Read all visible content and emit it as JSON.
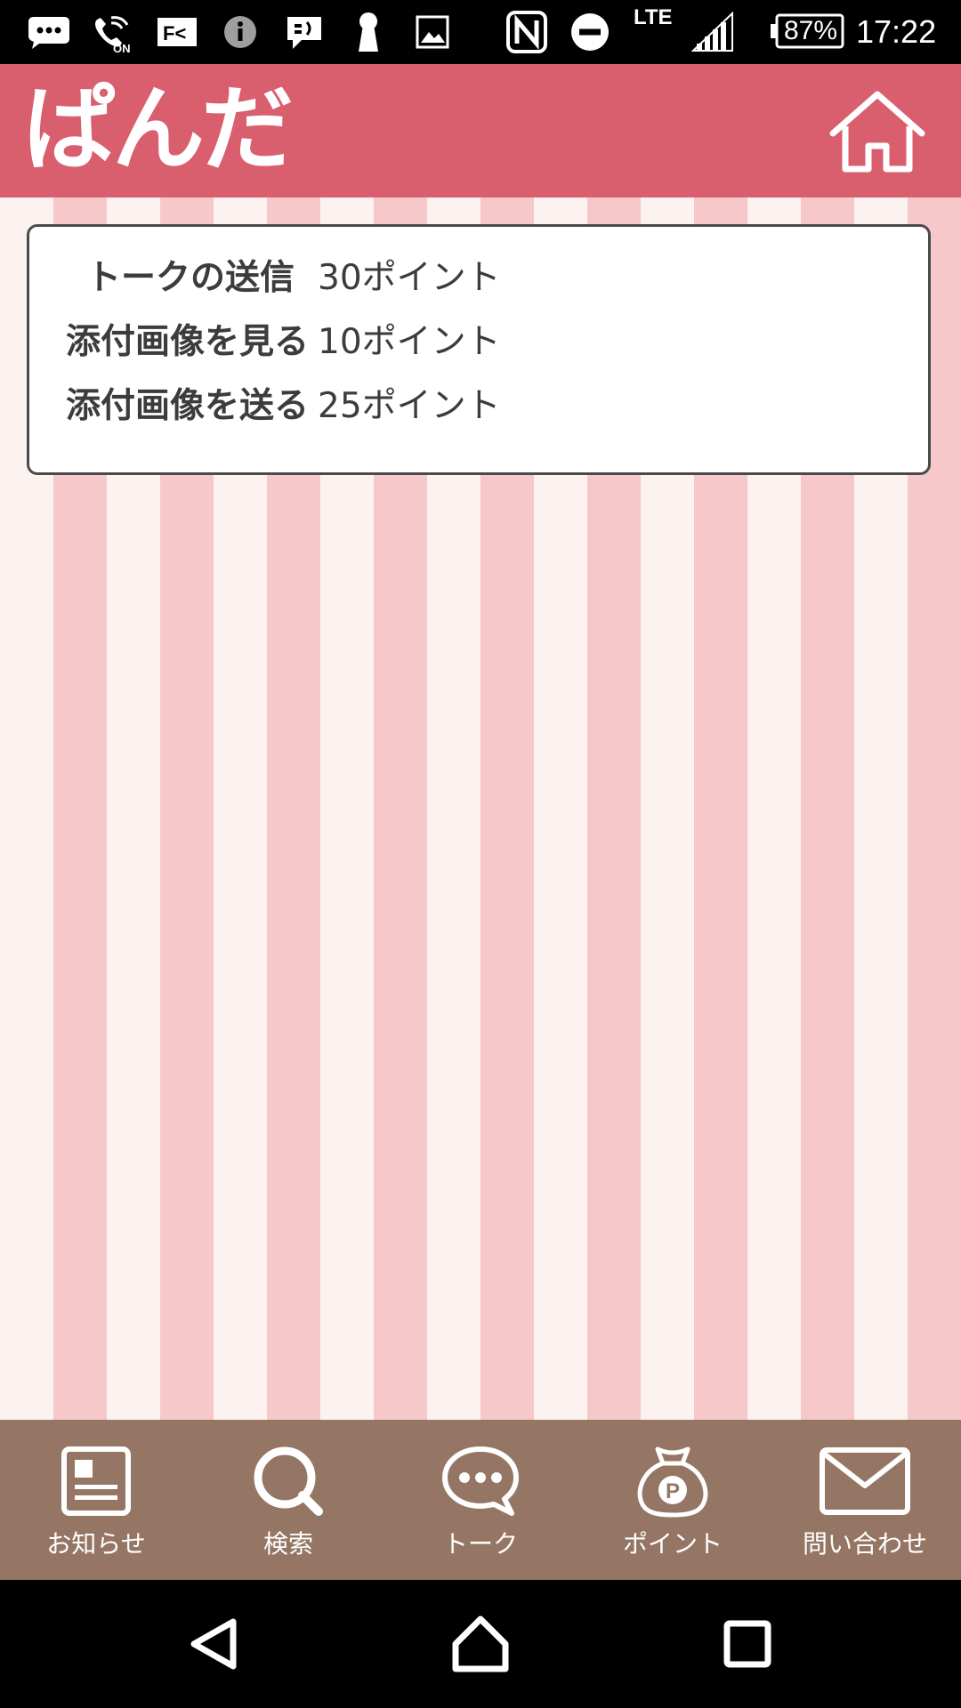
{
  "status_bar": {
    "icons": [
      "chat-icon",
      "wifi-calling-on-icon",
      "fk-app-icon",
      "info-icon",
      "message-icon",
      "keyhole-icon",
      "image-icon",
      "nfc-icon",
      "do-not-disturb-icon",
      "cellular-signal-icon",
      "battery-icon"
    ],
    "network": "LTE",
    "battery": "87%",
    "time": "17:22"
  },
  "header": {
    "logo_text": "ぱんだ",
    "home_icon": "home-icon",
    "brand_color": "#d95f6e"
  },
  "rates": [
    {
      "label": "トークの送信",
      "value": "30ポイント"
    },
    {
      "label": "添付画像を見る",
      "value": "10ポイント"
    },
    {
      "label": "添付画像を送る",
      "value": "25ポイント"
    }
  ],
  "tabs": [
    {
      "label": "お知らせ",
      "icon": "news-icon"
    },
    {
      "label": "検索",
      "icon": "search-icon"
    },
    {
      "label": "トーク",
      "icon": "chat-bubble-icon"
    },
    {
      "label": "ポイント",
      "icon": "point-bag-icon"
    },
    {
      "label": "問い合わせ",
      "icon": "mail-icon"
    }
  ],
  "colors": {
    "tab_bar": "#957563",
    "stripe_light": "#fcf3f1",
    "stripe_pink": "#f6c8c9"
  },
  "nav_bar": {
    "icons": [
      "back-icon",
      "home-nav-icon",
      "recents-icon"
    ]
  }
}
